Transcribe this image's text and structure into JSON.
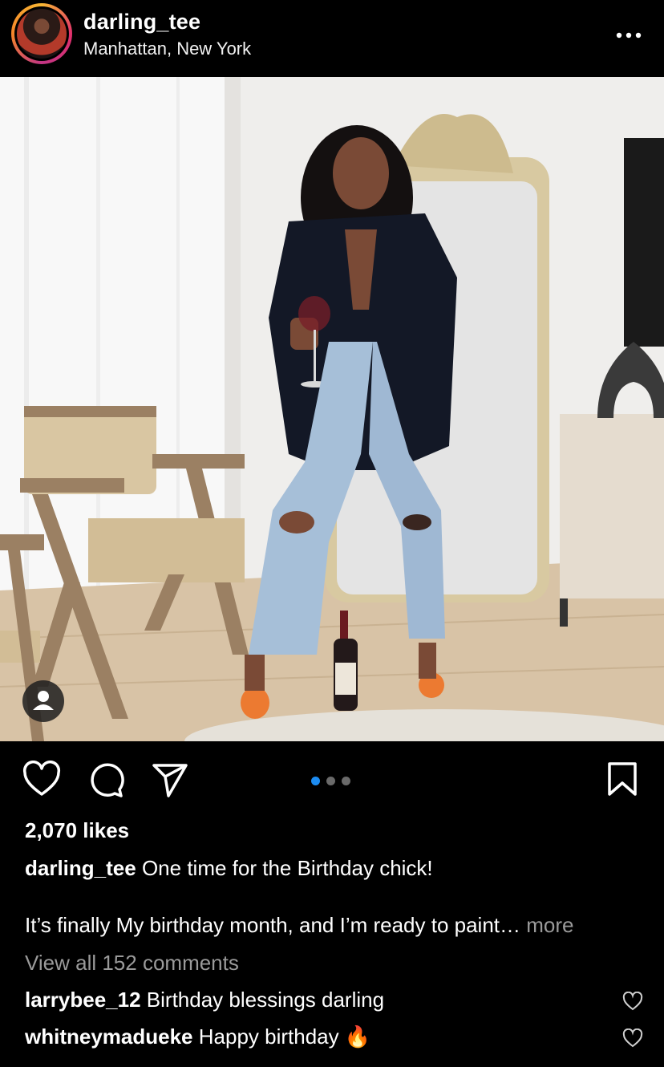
{
  "header": {
    "username": "darling_tee",
    "location": "Manhattan, New York",
    "more_icon": "more-horizontal-icon"
  },
  "post": {
    "carousel": {
      "total": 3,
      "active_index": 0
    },
    "likes": "2,070 likes",
    "caption": {
      "username": "darling_tee",
      "text": "One time for the Birthday chick!",
      "second_line": "It’s finally My birthday month, and I’m ready to paint…",
      "more_label": "more"
    },
    "view_all_comments": "View all 152 comments",
    "comments": [
      {
        "username": "larrybee_12",
        "text": "Birthday blessings darling"
      },
      {
        "username": "whitneymadueke",
        "text": "Happy birthday 🔥"
      }
    ]
  },
  "icons": {
    "like": "heart-icon",
    "comment": "comment-icon",
    "share": "send-icon",
    "save": "bookmark-icon",
    "user_tags": "user-tag-icon"
  },
  "colors": {
    "background": "#000000",
    "text": "#ffffff",
    "muted": "#9a9a9a",
    "carousel_active": "#1c8cf2"
  }
}
